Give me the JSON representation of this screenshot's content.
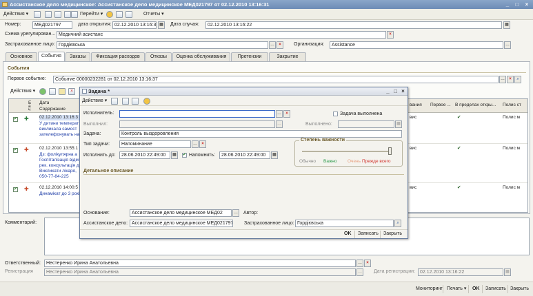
{
  "window": {
    "title": "Ассистанское дело медицинское: Ассистанское дело медицинское МЕД021797 от 02.12.2010 13:16:31"
  },
  "toolbar": {
    "actions": "Действия",
    "goto": "Перейти",
    "reports": "Отчеты"
  },
  "header": {
    "number_label": "Номер:",
    "number": "МЕД021797",
    "open_date_label": "дата открытия:",
    "open_date": "02.12.2010 13:16:31",
    "case_date_label": "Дата случая:",
    "case_date": "02.12.2010 13:16:22",
    "scheme_label": "Схема урегулирован...",
    "scheme": "Медичний асистанс",
    "insured_label": "Застрахованное лицо:",
    "insured": "Гордієвська",
    "org_label": "Организация:",
    "org": "Assistance"
  },
  "tabs": [
    "Основное",
    "События",
    "Заказы",
    "Фиксация расходов",
    "Отказы",
    "Оценка обслуживания",
    "Претензии",
    "Закрытие"
  ],
  "events": {
    "section_title": "События",
    "first_event_label": "Первое событие:",
    "first_event": "Событие 00000232281 от 02.12.2010 13:16:37",
    "actions": "Действия",
    "columns": [
      "Е",
      "Дата",
      "Содержание",
      "вания",
      "Первое ...",
      "В пределах откры...",
      "Полис ст"
    ],
    "col_sub": [
      "а",
      "ч"
    ],
    "rows": [
      {
        "date": "02.12.2010 13:16:3",
        "lines": [
          "У дитини температ",
          "викликала самост",
          "зателефонувать на"
        ],
        "right": "вис",
        "check": "✔",
        "policy": "Полис м"
      },
      {
        "date": "02.12.2010 13:55:1",
        "lines": [
          "Дз: фолікулярна а",
          "Госпіталізація відм",
          "рек. консультація д",
          "Викликати лікаря, ",
          "050-77-84-225"
        ],
        "right": "вис",
        "check": "✔",
        "policy": "Полис м"
      },
      {
        "date": "02.12.2010 14:00:5",
        "lines": [
          "Динамікат до 3 рокі"
        ],
        "right": "вис",
        "check": "✔",
        "policy": "Полис м"
      }
    ]
  },
  "dialog": {
    "title": "Задача *",
    "actions": "Действие",
    "executor_label": "Исполнитель:",
    "executor": "",
    "done_check_label": "Задача выполнена",
    "performed_label": "Выполнил:",
    "performed_on_label": "Выполнено:",
    "task_label": "Задача:",
    "task": "Контроль выздоровления",
    "type_label": "Тип задачи:",
    "type": "Напоминание",
    "deadline_label": "Исполнить до:",
    "deadline": "28.06.2010 22:49:00",
    "remind_label": "Напомнить:",
    "remind": "28.06.2010 22:49:00",
    "importance_title": "Степень важности",
    "importance_levels": [
      "Обычно",
      "Важно",
      "Очень",
      "Прежде всего"
    ],
    "importance_level": 1.0,
    "details_title": "Детальное описание",
    "basis_label": "Основание:",
    "basis": "Ассистанское дело медицинское МЕД02",
    "author_label": "Автор:",
    "case_label": "Ассистанское дело:",
    "case": "Ассистанское дело медицинское МЕД021797 о",
    "insured_label": "Застрахованное лицо:",
    "insured": "Гордієвська",
    "ok": "OK",
    "save": "Записать",
    "close": "Закрыть"
  },
  "footer": {
    "comment_label": "Комментарий:",
    "responsible_label": "Ответственный:",
    "responsible": "Нестеренко Ирина Анатольевна",
    "registration_label": "Регистрация",
    "registration": "Нестеренко Ирина Анатольевна",
    "reg_date_label": "Дата регистрации:",
    "reg_date": "02.12.2010 13:16:22"
  },
  "statusbar": {
    "monitoring": "Мониторинг",
    "print": "Печать",
    "ok": "OK",
    "save": "Записать",
    "close": "Закрыть"
  },
  "colors": {
    "title": "#6d8cb6",
    "accent": "#6b5a2a",
    "event_text": "#2240a8",
    "urgent": "#d0302a",
    "important": "#2a9a4a"
  }
}
